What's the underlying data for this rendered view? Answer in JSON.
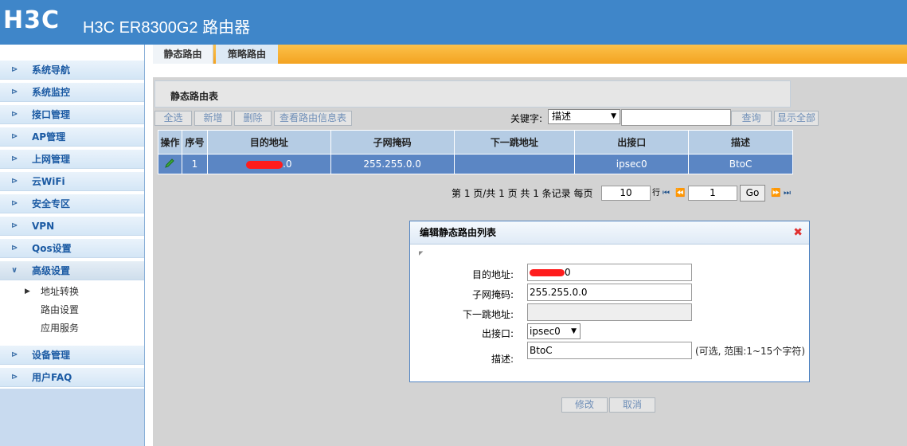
{
  "header": {
    "logo": "H3C",
    "product": "H3C ER8300G2 路由器"
  },
  "sidebar": {
    "items": [
      {
        "label": "系统导航"
      },
      {
        "label": "系统监控"
      },
      {
        "label": "接口管理"
      },
      {
        "label": "AP管理"
      },
      {
        "label": "上网管理"
      },
      {
        "label": "云WiFi"
      },
      {
        "label": "安全专区"
      },
      {
        "label": "VPN"
      },
      {
        "label": "Qos设置"
      },
      {
        "label": "高级设置"
      },
      {
        "label": "设备管理"
      },
      {
        "label": "用户FAQ"
      }
    ],
    "subitems": [
      {
        "label": "地址转换"
      },
      {
        "label": "路由设置"
      },
      {
        "label": "应用服务"
      }
    ]
  },
  "tabs": [
    {
      "label": "静态路由"
    },
    {
      "label": "策略路由"
    }
  ],
  "panel": {
    "title": "静态路由表"
  },
  "toolbar": {
    "select_all": "全选",
    "add": "新增",
    "delete": "删除",
    "view_info": "查看路由信息表",
    "keyword_label": "关键字:",
    "keyword_value": "描述",
    "search": "查询",
    "show_all": "显示全部"
  },
  "table": {
    "headers": [
      "操作",
      "序号",
      "目的地址",
      "子网掩码",
      "下一跳地址",
      "出接口",
      "描述"
    ],
    "rows": [
      {
        "index": "1",
        "dest_suffix": ".0",
        "mask": "255.255.0.0",
        "next_hop": "",
        "iface": "ipsec0",
        "desc": "BtoC"
      }
    ]
  },
  "pager": {
    "text": "第 1 页/共 1 页 共 1 条记录 每页",
    "per_page": "10",
    "row_unit": "行",
    "page": "1",
    "go": "Go"
  },
  "dialog": {
    "title": "编辑静态路由列表",
    "dest_label": "目的地址:",
    "dest_value": "0",
    "mask_label": "子网掩码:",
    "mask_value": "255.255.0.0",
    "nexthop_label": "下一跳地址:",
    "nexthop_value": "",
    "iface_label": "出接口:",
    "iface_value": "ipsec0",
    "desc_label": "描述:",
    "desc_value": "BtoC",
    "hint": "(可选, 范围:1~15个字符)"
  },
  "actions": {
    "modify": "修改",
    "cancel": "取消"
  },
  "colors": {
    "header": "#3f86c9",
    "tabbar": "#f3a321",
    "row": "#5b86c4",
    "redact": "#ff1c1c"
  }
}
